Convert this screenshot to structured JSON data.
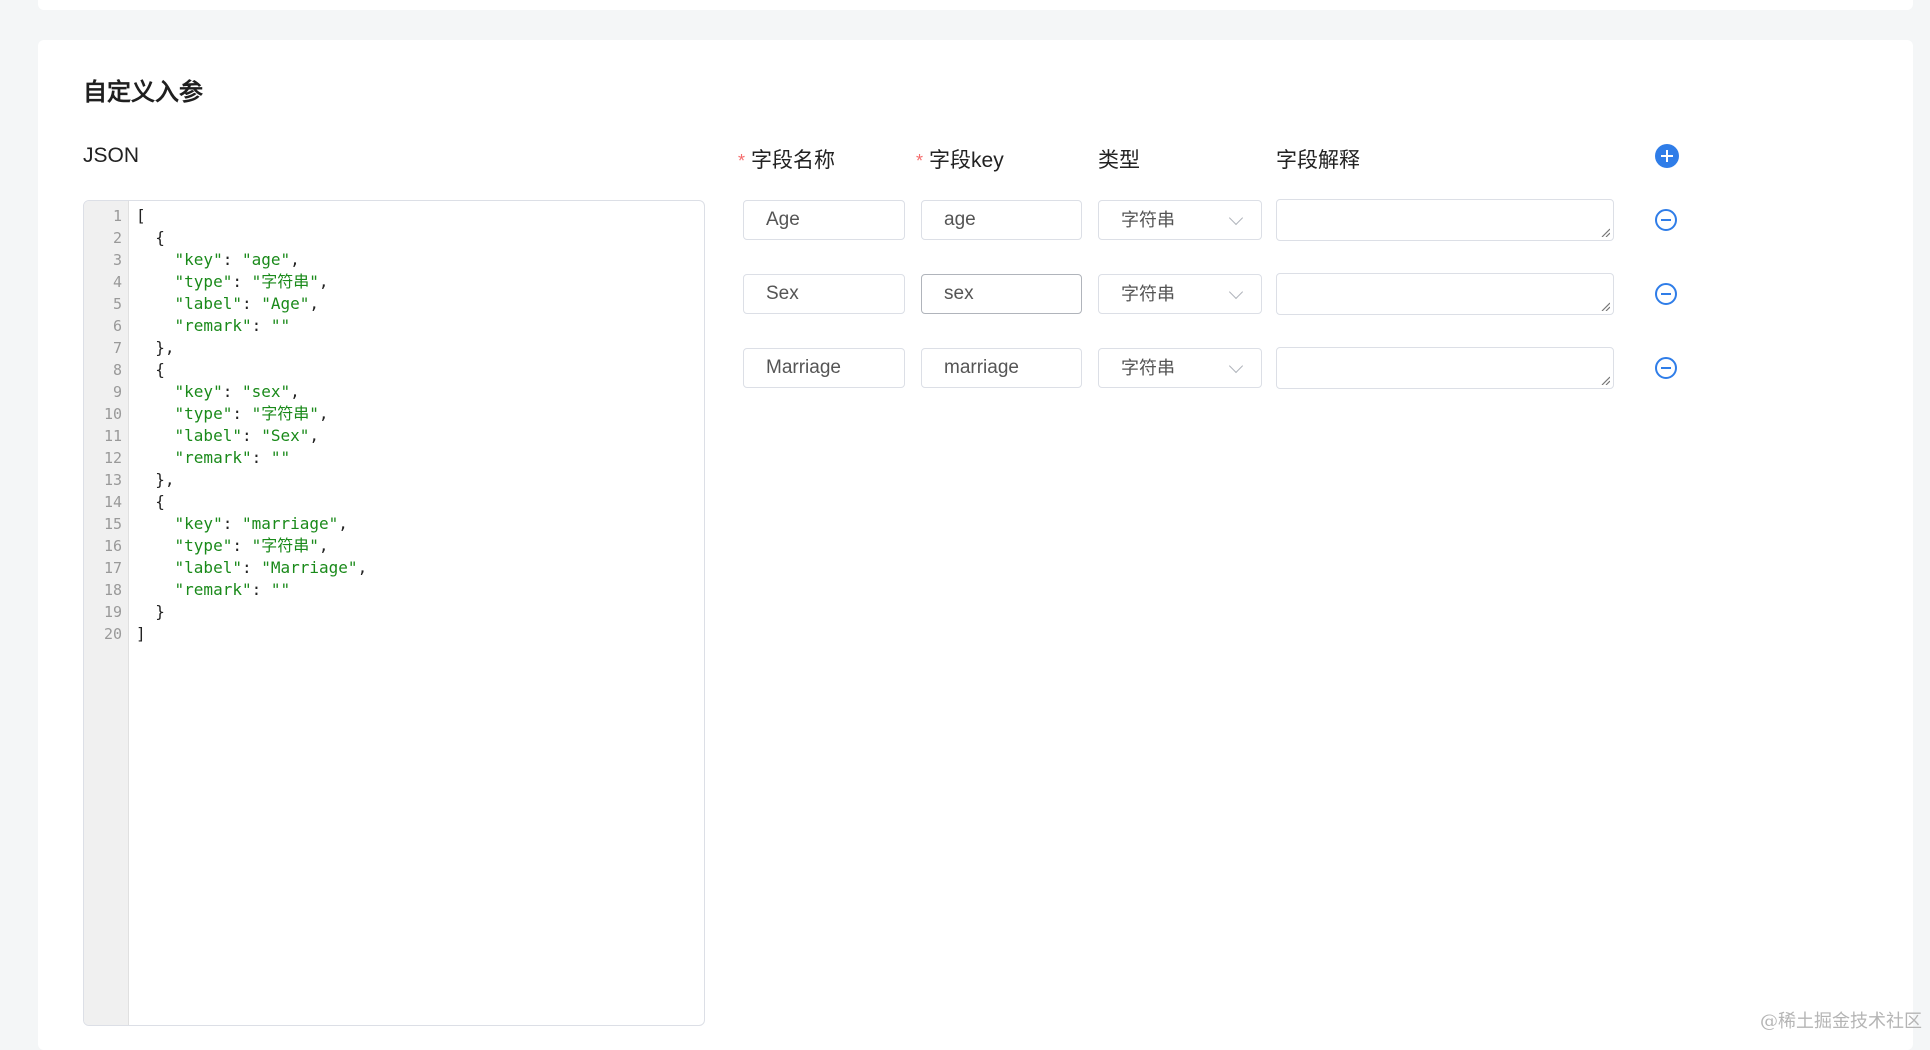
{
  "section": {
    "title": "自定义入参",
    "json_label": "JSON"
  },
  "editor": {
    "lines": [
      {
        "n": "1",
        "tokens": [
          {
            "t": "p",
            "v": "["
          }
        ]
      },
      {
        "n": "2",
        "tokens": [
          {
            "t": "p",
            "v": "  {"
          }
        ]
      },
      {
        "n": "3",
        "tokens": [
          {
            "t": "p",
            "v": "    "
          },
          {
            "t": "s",
            "v": "\"key\""
          },
          {
            "t": "p",
            "v": ": "
          },
          {
            "t": "s",
            "v": "\"age\""
          },
          {
            "t": "p",
            "v": ","
          }
        ]
      },
      {
        "n": "4",
        "tokens": [
          {
            "t": "p",
            "v": "    "
          },
          {
            "t": "s",
            "v": "\"type\""
          },
          {
            "t": "p",
            "v": ": "
          },
          {
            "t": "s",
            "v": "\"字符串\""
          },
          {
            "t": "p",
            "v": ","
          }
        ]
      },
      {
        "n": "5",
        "tokens": [
          {
            "t": "p",
            "v": "    "
          },
          {
            "t": "s",
            "v": "\"label\""
          },
          {
            "t": "p",
            "v": ": "
          },
          {
            "t": "s",
            "v": "\"Age\""
          },
          {
            "t": "p",
            "v": ","
          }
        ]
      },
      {
        "n": "6",
        "tokens": [
          {
            "t": "p",
            "v": "    "
          },
          {
            "t": "s",
            "v": "\"remark\""
          },
          {
            "t": "p",
            "v": ": "
          },
          {
            "t": "s",
            "v": "\"\""
          }
        ]
      },
      {
        "n": "7",
        "tokens": [
          {
            "t": "p",
            "v": "  },"
          }
        ]
      },
      {
        "n": "8",
        "tokens": [
          {
            "t": "p",
            "v": "  {"
          }
        ]
      },
      {
        "n": "9",
        "tokens": [
          {
            "t": "p",
            "v": "    "
          },
          {
            "t": "s",
            "v": "\"key\""
          },
          {
            "t": "p",
            "v": ": "
          },
          {
            "t": "s",
            "v": "\"sex\""
          },
          {
            "t": "p",
            "v": ","
          }
        ]
      },
      {
        "n": "10",
        "tokens": [
          {
            "t": "p",
            "v": "    "
          },
          {
            "t": "s",
            "v": "\"type\""
          },
          {
            "t": "p",
            "v": ": "
          },
          {
            "t": "s",
            "v": "\"字符串\""
          },
          {
            "t": "p",
            "v": ","
          }
        ]
      },
      {
        "n": "11",
        "tokens": [
          {
            "t": "p",
            "v": "    "
          },
          {
            "t": "s",
            "v": "\"label\""
          },
          {
            "t": "p",
            "v": ": "
          },
          {
            "t": "s",
            "v": "\"Sex\""
          },
          {
            "t": "p",
            "v": ","
          }
        ]
      },
      {
        "n": "12",
        "tokens": [
          {
            "t": "p",
            "v": "    "
          },
          {
            "t": "s",
            "v": "\"remark\""
          },
          {
            "t": "p",
            "v": ": "
          },
          {
            "t": "s",
            "v": "\"\""
          }
        ]
      },
      {
        "n": "13",
        "tokens": [
          {
            "t": "p",
            "v": "  },"
          }
        ]
      },
      {
        "n": "14",
        "tokens": [
          {
            "t": "p",
            "v": "  {"
          }
        ]
      },
      {
        "n": "15",
        "tokens": [
          {
            "t": "p",
            "v": "    "
          },
          {
            "t": "s",
            "v": "\"key\""
          },
          {
            "t": "p",
            "v": ": "
          },
          {
            "t": "s",
            "v": "\"marriage\""
          },
          {
            "t": "p",
            "v": ","
          }
        ]
      },
      {
        "n": "16",
        "tokens": [
          {
            "t": "p",
            "v": "    "
          },
          {
            "t": "s",
            "v": "\"type\""
          },
          {
            "t": "p",
            "v": ": "
          },
          {
            "t": "s",
            "v": "\"字符串\""
          },
          {
            "t": "p",
            "v": ","
          }
        ]
      },
      {
        "n": "17",
        "tokens": [
          {
            "t": "p",
            "v": "    "
          },
          {
            "t": "s",
            "v": "\"label\""
          },
          {
            "t": "p",
            "v": ": "
          },
          {
            "t": "s",
            "v": "\"Marriage\""
          },
          {
            "t": "p",
            "v": ","
          }
        ]
      },
      {
        "n": "18",
        "tokens": [
          {
            "t": "p",
            "v": "    "
          },
          {
            "t": "s",
            "v": "\"remark\""
          },
          {
            "t": "p",
            "v": ": "
          },
          {
            "t": "s",
            "v": "\"\""
          }
        ]
      },
      {
        "n": "19",
        "tokens": [
          {
            "t": "p",
            "v": "  }"
          }
        ]
      },
      {
        "n": "20",
        "tokens": [
          {
            "t": "p",
            "v": "]"
          }
        ]
      }
    ]
  },
  "columns": {
    "name": "字段名称",
    "key": "字段key",
    "type": "类型",
    "remark": "字段解释",
    "required_mark": "*"
  },
  "rows": [
    {
      "name": "Age",
      "key": "age",
      "type": "字符串",
      "remark": ""
    },
    {
      "name": "Sex",
      "key": "sex",
      "type": "字符串",
      "remark": ""
    },
    {
      "name": "Marriage",
      "key": "marriage",
      "type": "字符串",
      "remark": ""
    }
  ],
  "colors": {
    "accent": "#2f7de8",
    "required": "#f56c6c",
    "json_string": "#1a8a1a"
  },
  "icons": {
    "add": "plus-circle-filled-icon",
    "remove": "minus-circle-outline-icon",
    "select": "chevron-down-icon",
    "resize": "resize-handle-icon"
  },
  "watermark": "@稀土掘金技术社区"
}
